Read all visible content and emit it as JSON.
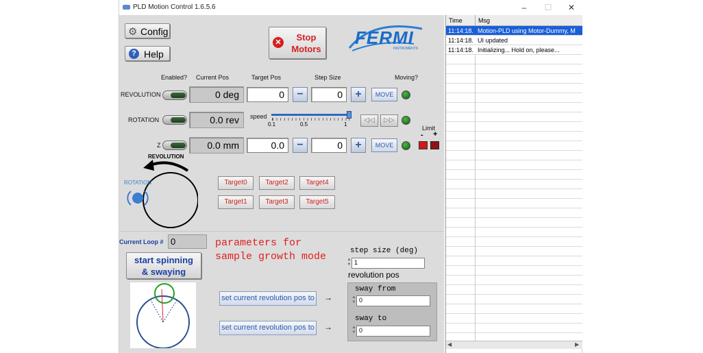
{
  "window": {
    "title": "PLD Motion Control 1.6.5.6",
    "controls": {
      "minimize": "–",
      "maximize": "☐",
      "close": "✕"
    }
  },
  "toolbar": {
    "config_label": "Config",
    "help_label": "Help",
    "stop_label_1": "Stop",
    "stop_label_2": "Motors",
    "logo_text": "FERMI",
    "logo_sub": "INSTRUMENTS"
  },
  "headers": {
    "enabled": "Enabled?",
    "current": "Current Pos",
    "target": "Target Pos",
    "step": "Step Size",
    "moving": "Moving?"
  },
  "axes": {
    "revolution": {
      "label": "REVOLUTION",
      "current": "0 deg",
      "target": "0",
      "step": "0",
      "move": "MOVE"
    },
    "rotation": {
      "label": "ROTATION",
      "current": "0.0 rev",
      "speed_label": "speed",
      "speed_ticks": [
        "0.1",
        "0.5",
        "1"
      ],
      "speed_value": 1
    },
    "z": {
      "label": "Z",
      "current": "0.0 mm",
      "target": "0.0",
      "step": "0",
      "move": "MOVE"
    }
  },
  "limit": {
    "label": "Limit",
    "minus": "-",
    "plus": "+",
    "color": "#d01818"
  },
  "diagram": {
    "revolution_label": "REVOLUTION",
    "rotation_label": "ROTATION"
  },
  "targets": [
    "Target0",
    "Target2",
    "Target4",
    "Target1",
    "Target3",
    "Target5"
  ],
  "loop": {
    "label": "Current Loop #",
    "value": "0",
    "spin_label_1": "start spinning",
    "spin_label_2": "& swaying"
  },
  "params": {
    "heading_1": "parameters for",
    "heading_2": "sample growth mode",
    "step_label": "step size (deg)",
    "step_value": "1",
    "rev_pos_label": "revolution pos",
    "set_btn_1": "set current revolution pos to",
    "set_btn_2": "set current revolution pos to",
    "sway_from_label": "sway from",
    "sway_from_value": "0",
    "sway_to_label": "sway to",
    "sway_to_value": "0"
  },
  "log": {
    "col_time": "Time",
    "col_msg": "Msg",
    "rows": [
      {
        "time": "11:14:18.",
        "msg": "Motion-PLD using Motor-Dummy, M",
        "selected": true
      },
      {
        "time": "11:14:18.",
        "msg": "UI updated",
        "selected": false
      },
      {
        "time": "11:14:18.",
        "msg": "Initializing... Hold on, please...",
        "selected": false
      }
    ]
  }
}
